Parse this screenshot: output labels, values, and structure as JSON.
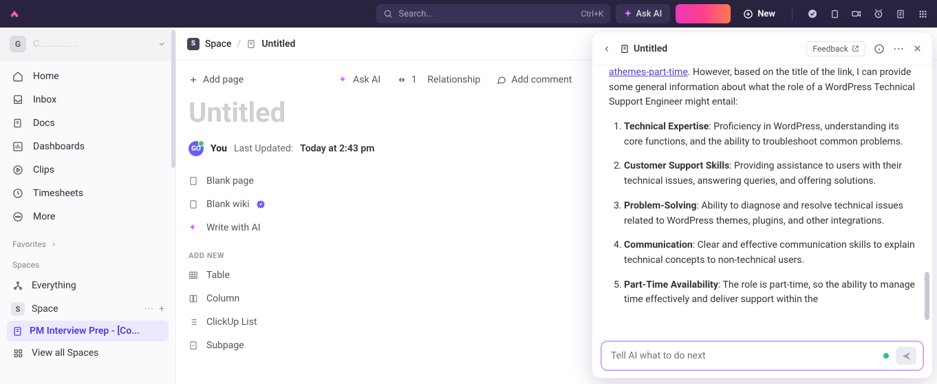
{
  "topbar": {
    "search_placeholder": "Search...",
    "search_kbd": "Ctrl+K",
    "askai_label": "Ask AI",
    "new_label": "New"
  },
  "workspace": {
    "initial": "G",
    "name_placeholder": "C..............."
  },
  "nav": {
    "home": "Home",
    "inbox": "Inbox",
    "docs": "Docs",
    "dashboards": "Dashboards",
    "clips": "Clips",
    "timesheets": "Timesheets",
    "more": "More"
  },
  "sections": {
    "favorites": "Favorites",
    "spaces": "Spaces",
    "everything": "Everything",
    "space": "Space",
    "pm_item": "PM Interview Prep - [Co...",
    "view_all": "View all Spaces"
  },
  "crumb": {
    "space": "Space",
    "title": "Untitled"
  },
  "doc": {
    "toolbar": {
      "add_page": "Add page",
      "ask_ai": "Ask AI",
      "relationship_count": "1",
      "relationship_label": "Relationship",
      "add_comment": "Add comment"
    },
    "title": "Untitled",
    "byline": {
      "you": "You",
      "updated_label": "Last Updated:",
      "updated_value": "Today at 2:43 pm"
    },
    "options": {
      "blank_page": "Blank page",
      "blank_wiki": "Blank wiki",
      "write_ai": "Write with AI"
    },
    "addnew": {
      "heading": "ADD NEW",
      "table": "Table",
      "column": "Column",
      "clickup_list": "ClickUp List",
      "subpage": "Subpage"
    }
  },
  "ai": {
    "title": "Untitled",
    "feedback": "Feedback",
    "link_text": "athemes-part-time",
    "intro_tail": ". However, based on the title of the link, I can provide some general information about what the role of a WordPress Technical Support Engineer might entail:",
    "items": [
      {
        "b": "Technical Expertise",
        "t": ": Proficiency in WordPress, understanding its core functions, and the ability to troubleshoot common problems."
      },
      {
        "b": "Customer Support Skills",
        "t": ": Providing assistance to users with their technical issues, answering queries, and offering solutions."
      },
      {
        "b": "Problem-Solving",
        "t": ": Ability to diagnose and resolve technical issues related to WordPress themes, plugins, and other integrations."
      },
      {
        "b": "Communication",
        "t": ": Clear and effective communication skills to explain technical concepts to non-technical users."
      },
      {
        "b": "Part-Time Availability",
        "t": ": The role is part-time, so the ability to manage time effectively and deliver support within the"
      }
    ],
    "input_placeholder": "Tell AI what to do next"
  }
}
